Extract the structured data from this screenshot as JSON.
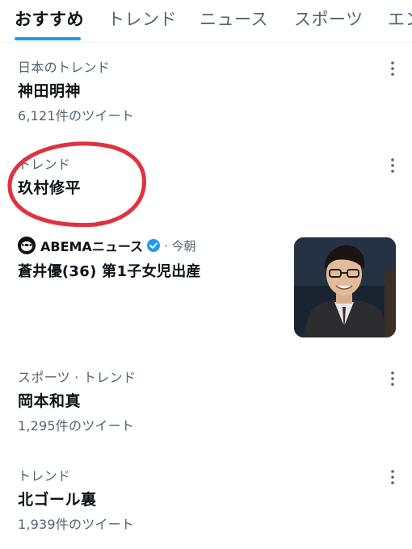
{
  "tabs": [
    {
      "label": "おすすめ",
      "active": true
    },
    {
      "label": "トレンド",
      "active": false
    },
    {
      "label": "ニュース",
      "active": false
    },
    {
      "label": "スポーツ",
      "active": false
    },
    {
      "label": "エン",
      "active": false
    }
  ],
  "trends": [
    {
      "meta": "日本のトレンド",
      "title": "神田明神",
      "count": "6,121件のツイート"
    },
    {
      "meta": "トレンド",
      "title": "玖村修平"
    },
    {
      "meta": "スポーツ · トレンド",
      "title": "岡本和真",
      "count": "1,295件のツイート"
    },
    {
      "meta": "トレンド",
      "title": "北ゴール裏",
      "count": "1,939件のツイート"
    }
  ],
  "news": {
    "source": "ABEMAニュース",
    "time": "· 今朝",
    "headline": "蒼井優(36) 第1子女児出産"
  },
  "colors": {
    "accent": "#1d9bf0",
    "annotation": "#e0323f",
    "text_primary": "#0f1419",
    "text_secondary": "#536471"
  },
  "icons": {
    "more": "more-vertical-icon",
    "verified": "verified-badge-icon",
    "avatar": "abema-logo-icon"
  }
}
